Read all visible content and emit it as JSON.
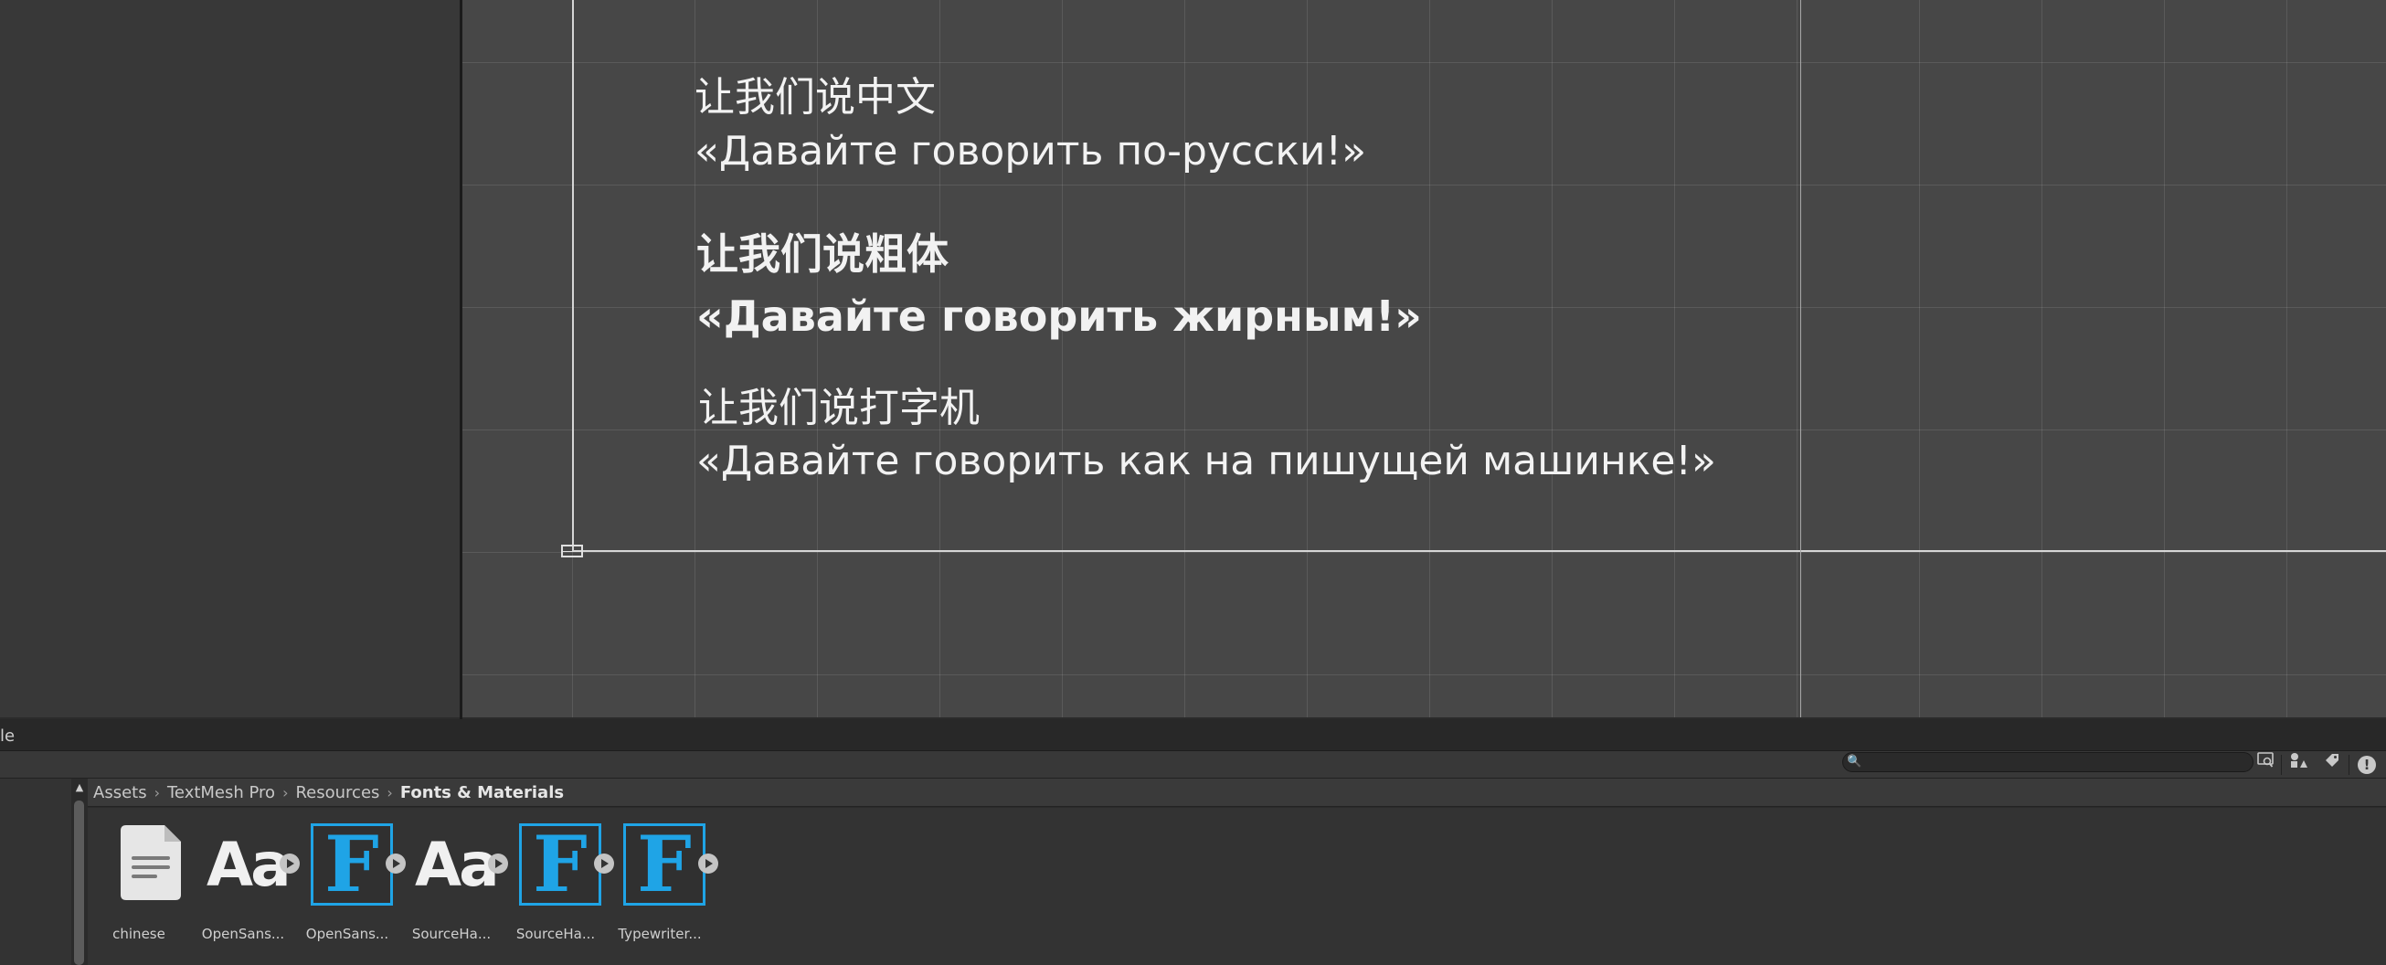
{
  "scene": {
    "texts": [
      "让我们说中文",
      "«Давайте говорить по-русски!»",
      "让我们说粗体",
      "«Давайте говорить жирным!»",
      "让我们说打字机",
      "«Давайте говорить как на пишущей машинке!»"
    ]
  },
  "project_window": {
    "tab_label": "le",
    "search": {
      "value": "",
      "placeholder": ""
    },
    "toolbar_icons": [
      "search-icon",
      "scene-search-icon",
      "filter-by-type-icon",
      "filter-by-label-icon",
      "warning-icon"
    ],
    "breadcrumb": [
      "Assets",
      "TextMesh Pro",
      "Resources",
      "Fonts & Materials"
    ],
    "assets": [
      {
        "label": "chinese",
        "icon": "text-document-icon"
      },
      {
        "label": "OpenSans...",
        "icon": "font-icon"
      },
      {
        "label": "OpenSans...",
        "icon": "font-asset-icon"
      },
      {
        "label": "SourceHa...",
        "icon": "font-icon"
      },
      {
        "label": "SourceHa...",
        "icon": "font-asset-icon"
      },
      {
        "label": "Typewriter...",
        "icon": "font-asset-icon"
      }
    ],
    "font_glyph": "Aa",
    "font_asset_glyph": "F",
    "accent_color": "#1fa4e6"
  }
}
